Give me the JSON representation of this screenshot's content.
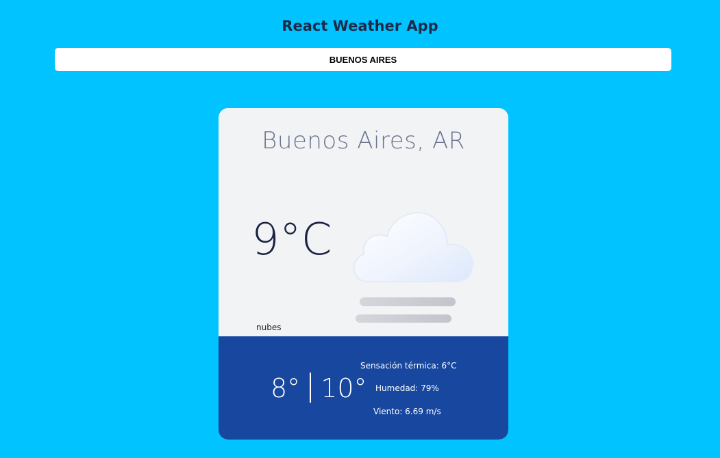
{
  "header": {
    "title": "React Weather App"
  },
  "search": {
    "value": "BUENOS AIRES"
  },
  "weather": {
    "city": "Buenos Aires, AR",
    "temperature": "9°C",
    "description": "nubes",
    "icon": "cloud-fog-icon",
    "min": "8°",
    "max": "10°",
    "feels_like": "Sensación térmica: 6°C",
    "humidity": "Humedad: 79%",
    "wind": "Viento: 6.69 m/s"
  },
  "colors": {
    "background": "#00c3ff",
    "card": "#f2f3f5",
    "card_bottom": "#17479e",
    "title": "#1c2a4a"
  }
}
